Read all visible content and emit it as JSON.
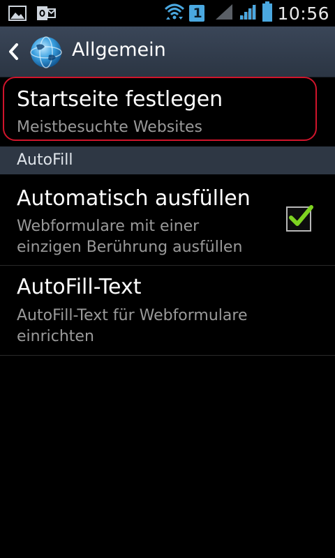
{
  "status_bar": {
    "time": "10:56",
    "badge": "1",
    "left_icons": [
      "gallery-icon",
      "outlook-icon"
    ],
    "right_icons": [
      "wifi-icon",
      "sim-badge",
      "no-signal-icon",
      "signal-icon",
      "battery-icon"
    ]
  },
  "action_bar": {
    "title": "Allgemein",
    "back_icon": "chevron-left-icon",
    "app_icon": "globe-icon"
  },
  "settings": {
    "homepage": {
      "title": "Startseite festlegen",
      "summary": "Meistbesuchte Websites"
    },
    "section_autofill": "AutoFill",
    "auto_fill": {
      "title": "Automatisch ausfüllen",
      "summary_line1": "Webformulare mit einer",
      "summary_line2": "einzigen Berührung ausfüllen",
      "checked": true
    },
    "autofill_text": {
      "title": "AutoFill-Text",
      "summary_line1": "AutoFill-Text für Webformulare",
      "summary_line2": "einrichten"
    }
  },
  "colors": {
    "highlight": "#d0142b",
    "check": "#7ed321",
    "section_bg": "#2e3744",
    "actionbar_bg": "#323d4c"
  }
}
